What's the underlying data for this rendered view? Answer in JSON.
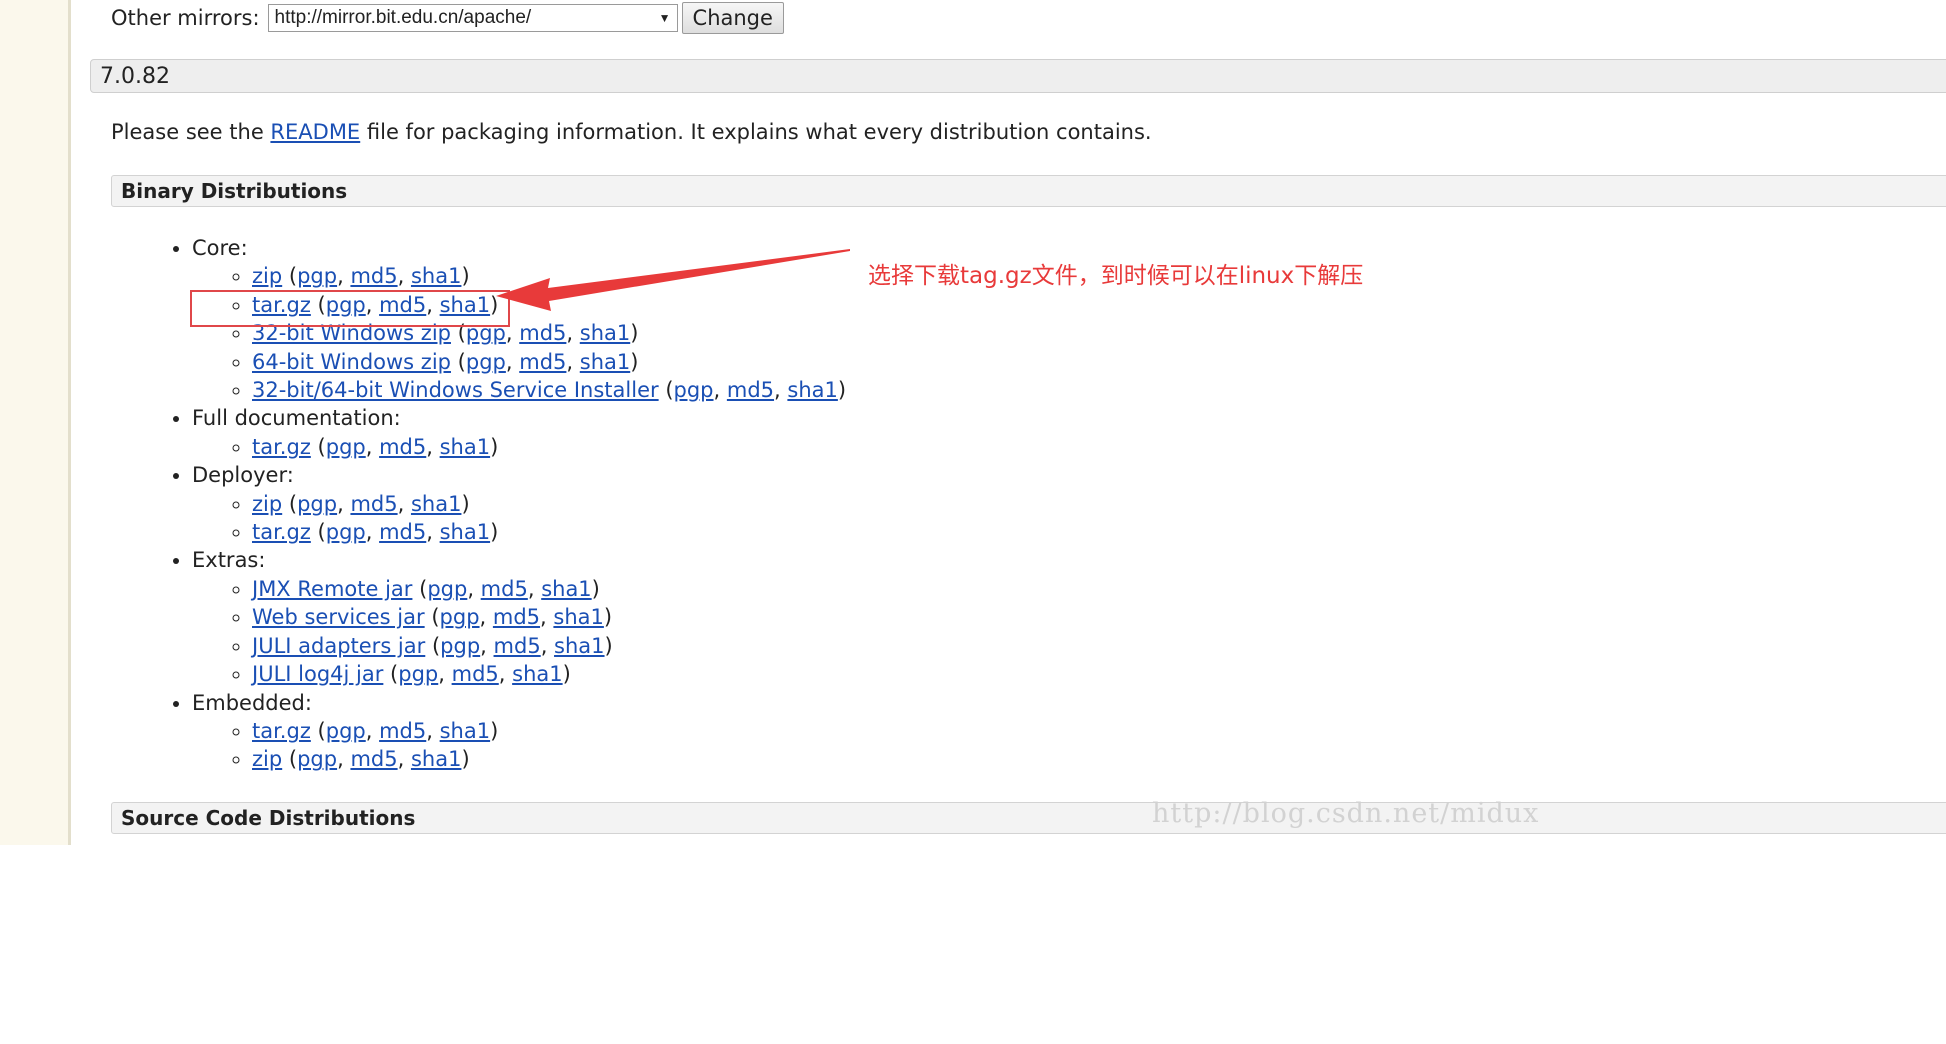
{
  "mirror": {
    "label": "Other mirrors:",
    "selected": "http://mirror.bit.edu.cn/apache/",
    "change_button": "Change"
  },
  "version": "7.0.82",
  "readme": {
    "before": "Please see the ",
    "link": "README",
    "after": " file for packaging information. It explains what every distribution contains."
  },
  "sections": {
    "binary": "Binary Distributions",
    "source": "Source Code Distributions"
  },
  "links": {
    "open": "(",
    "pgp": "pgp",
    "comma": ", ",
    "md5": "md5",
    "sha1": "sha1",
    "close": ")"
  },
  "groups": {
    "core": {
      "label": "Core:",
      "items": [
        "zip",
        "tar.gz",
        "32-bit Windows zip",
        "64-bit Windows zip",
        "32-bit/64-bit Windows Service Installer"
      ]
    },
    "docs": {
      "label": "Full documentation:",
      "items": [
        "tar.gz"
      ]
    },
    "deployer": {
      "label": "Deployer:",
      "items": [
        "zip",
        "tar.gz"
      ]
    },
    "extras": {
      "label": "Extras:",
      "items": [
        "JMX Remote jar",
        "Web services jar",
        "JULI adapters jar",
        "JULI log4j jar"
      ]
    },
    "embedded": {
      "label": "Embedded:",
      "items": [
        "tar.gz",
        "zip"
      ]
    }
  },
  "annotation": "选择下载tag.gz文件，到时候可以在linux下解压",
  "watermark": "http://blog.csdn.net/midux",
  "colors": {
    "link": "#1a4fb4",
    "annotation": "#e83a3a"
  }
}
